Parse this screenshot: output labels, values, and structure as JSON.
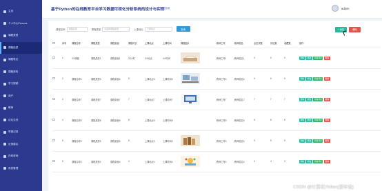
{
  "sidebar": {
    "items": [
      {
        "label": "主页",
        "active": false
      },
      {
        "label": "个人中心Persons",
        "active": false
      },
      {
        "label": "课程类型",
        "active": false
      },
      {
        "label": "课程信息",
        "active": true
      },
      {
        "label": "课程笔记",
        "active": false
      },
      {
        "label": "课程资料",
        "active": false
      },
      {
        "label": "学习视频",
        "active": false
      },
      {
        "label": "用户",
        "active": false
      },
      {
        "label": "教师",
        "active": false
      },
      {
        "label": "论坛交流",
        "active": false
      },
      {
        "label": "举报记录",
        "active": false
      },
      {
        "label": "反馈建议",
        "active": false
      },
      {
        "label": "在线咨询",
        "active": false
      },
      {
        "label": "系统管理",
        "active": false
      }
    ]
  },
  "header": {
    "title": "基于Python的在线教育平台学习数据可视化分析系统的设计与实现",
    "welcome": "课程信息",
    "user": "admin"
  },
  "search": {
    "fields": [
      {
        "label": "课程名称",
        "placeholder": "课程名称"
      },
      {
        "label": "课程类型",
        "placeholder": "请选择课程类型"
      },
      {
        "label": "上课地点",
        "placeholder": "上课地点"
      }
    ],
    "button": "查询"
  },
  "actions": {
    "add": "+ 添加",
    "delete": "删除"
  },
  "table": {
    "headers": [
      "",
      "序号",
      "课程名称",
      "课程类型",
      "课程封面",
      "课程时长",
      "上课地点",
      "上课时间",
      "课程图片",
      "",
      "教师工号",
      "教师姓名",
      "点击次数",
      "评论数",
      "收藏数",
      "操作"
    ],
    "ops": [
      "详情",
      "修改",
      "查看评论",
      "删除"
    ],
    "rows": [
      {
        "num": "1",
        "name": "XX课程",
        "type": "课程类型1",
        "cover": "课程封面1",
        "duration": "20小时",
        "place": "XX地点",
        "time": "XX时间",
        "teacher_no": "教师工号1",
        "teacher_name": "教师姓名1",
        "clicks": "0",
        "comments": "0",
        "favs": "0",
        "thumb": "book"
      },
      {
        "num": "2",
        "name": "课程名称6",
        "type": "课程类型6",
        "cover": "课程封面6",
        "duration": "6",
        "place": "上课地点6",
        "time": "上课时间6",
        "teacher_no": "教师工号6",
        "teacher_name": "教师姓名6",
        "clicks": "6",
        "comments": "6",
        "favs": "6",
        "thumb": "desk"
      },
      {
        "num": "3",
        "name": "课程名称7",
        "type": "课程类型7",
        "cover": "课程封面7",
        "duration": "7",
        "place": "上课地点7",
        "time": "上课时间7",
        "teacher_no": "教师工号7",
        "teacher_name": "教师姓名7",
        "clicks": "7",
        "comments": "7",
        "favs": "7",
        "thumb": "screen"
      },
      {
        "num": "4",
        "name": "课程名称8",
        "type": "课程类型8",
        "cover": "课程封面8",
        "duration": "8",
        "place": "上课地点8",
        "time": "上课时间8",
        "teacher_no": "教师工号8",
        "teacher_name": "教师姓名8",
        "clicks": "8",
        "comments": "8",
        "favs": "8",
        "thumb": "blank"
      },
      {
        "num": "5",
        "name": "课程名称5",
        "type": "课程类型5",
        "cover": "课程封面5",
        "duration": "5",
        "place": "上课地点5",
        "time": "上课时间5",
        "teacher_no": "教师工号5",
        "teacher_name": "教师姓名5",
        "clicks": "5",
        "comments": "5",
        "favs": "5",
        "thumb": "books"
      },
      {
        "num": "6",
        "name": "课程名称4",
        "type": "课程类型4",
        "cover": "课程封面4",
        "duration": "4",
        "place": "上课地点4",
        "time": "上课时间4",
        "teacher_no": "教师工号4",
        "teacher_name": "教师姓名4",
        "clicks": "4",
        "comments": "4",
        "favs": "4",
        "thumb": "art"
      }
    ]
  },
  "watermark": "CSDN @计算机Yidian(接毕设)",
  "colors": {
    "sidebar": "#2b3a8f",
    "sidebar_active": "#1b2a75",
    "accent": "#2f9bd6",
    "add": "#28b79b",
    "delete": "#e4534a"
  }
}
